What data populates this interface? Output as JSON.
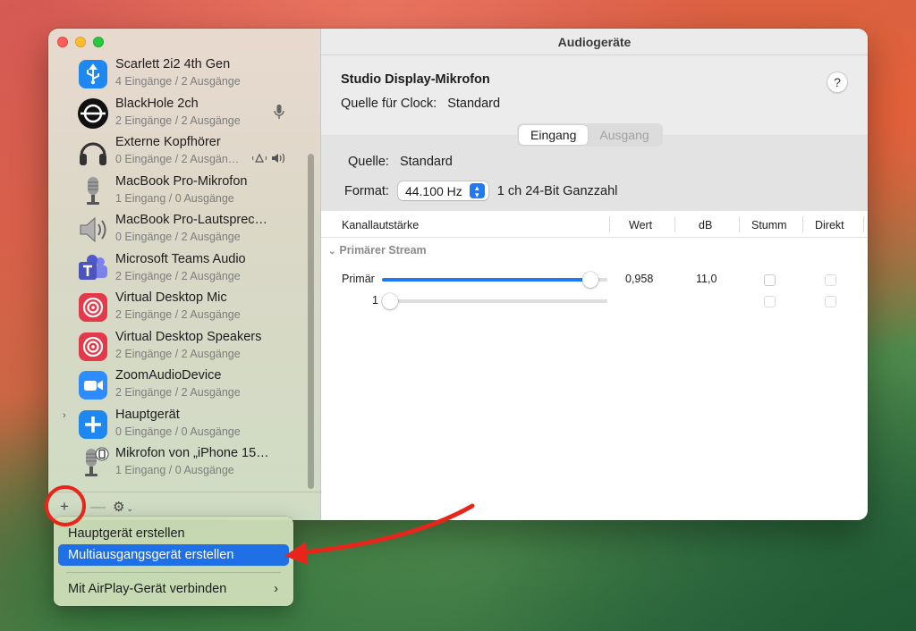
{
  "window": {
    "title": "Audiogeräte"
  },
  "sidebar": {
    "devices": [
      {
        "name": "Scarlett 2i2 4th Gen",
        "io": "4 Eingänge / 2 Ausgänge",
        "icon": "usb-icon"
      },
      {
        "name": "BlackHole 2ch",
        "io": "2 Eingänge / 2 Ausgänge",
        "icon": "blackhole-icon",
        "extra": "microphone-icon"
      },
      {
        "name": "Externe Kopfhörer",
        "io": "0 Eingänge / 2 Ausgän…",
        "icon": "headphones-icon",
        "extra": "alert-speaker-icons"
      },
      {
        "name": "MacBook Pro-Mikrofon",
        "io": "1 Eingang / 0 Ausgänge",
        "icon": "microphone-icon"
      },
      {
        "name": "MacBook Pro-Lautsprec…",
        "io": "0 Eingänge / 2 Ausgänge",
        "icon": "speaker-icon"
      },
      {
        "name": "Microsoft Teams Audio",
        "io": "2 Eingänge / 2 Ausgänge",
        "icon": "teams-icon"
      },
      {
        "name": "Virtual Desktop Mic",
        "io": "2 Eingänge / 2 Ausgänge",
        "icon": "virtual-desktop-icon"
      },
      {
        "name": "Virtual Desktop Speakers",
        "io": "2 Eingänge / 2 Ausgänge",
        "icon": "virtual-desktop-icon"
      },
      {
        "name": "ZoomAudioDevice",
        "io": "2 Eingänge / 2 Ausgänge",
        "icon": "zoom-icon"
      },
      {
        "name": "Hauptgerät",
        "io": "0 Eingänge / 0 Ausgänge",
        "icon": "aggregate-plus-icon"
      },
      {
        "name": "Mikrofon von „iPhone 15…",
        "io": "1 Eingang / 0 Ausgänge",
        "icon": "iphone-microphone-icon"
      }
    ],
    "footer": {
      "plus": "+",
      "minus": "—",
      "gear": "⚙"
    }
  },
  "detail": {
    "device_title": "Studio Display-Mikrofon",
    "clock_label": "Quelle für Clock:",
    "clock_value": "Standard",
    "help": "?",
    "tabs": [
      {
        "label": "Eingang",
        "active": true
      },
      {
        "label": "Ausgang",
        "active": false
      }
    ],
    "source_label": "Quelle:",
    "source_value": "Standard",
    "format_label": "Format:",
    "format_value": "44.100 Hz",
    "format_detail": "1 ch 24-Bit Ganzzahl",
    "table": {
      "headers": [
        "Kanallautstärke",
        "Wert",
        "dB",
        "Stumm",
        "Direkt"
      ],
      "stream_label": "Primärer Stream",
      "rows": [
        {
          "label": "Primär",
          "level": 0.958,
          "value": "0,958",
          "db": "11,0"
        },
        {
          "label": "1",
          "level": 0.0,
          "value": "",
          "db": ""
        }
      ]
    }
  },
  "menu": {
    "items": [
      {
        "label": "Hauptgerät erstellen"
      },
      {
        "label": "Multiausgangsgerät erstellen",
        "highlighted": true
      },
      {
        "label": "Mit AirPlay-Gerät verbinden",
        "submenu": true
      }
    ]
  },
  "colors": {
    "accent": "#1f7bf4",
    "annotation": "#e8251a"
  }
}
